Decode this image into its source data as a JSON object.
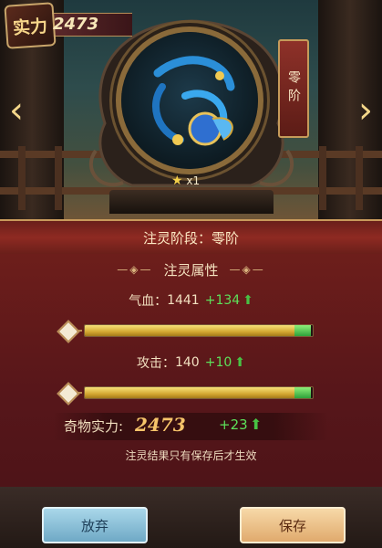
{
  "power": {
    "badge": "实力",
    "value": "2473"
  },
  "stage_tag": "零阶",
  "item": {
    "stars": "x1"
  },
  "stage_line": "注灵阶段：零阶",
  "section_title": "注灵属性",
  "section_deco_left": "—◈—",
  "section_deco_right": "—◈—",
  "attributes": [
    {
      "label": "气血：",
      "value": "1441",
      "increase": "+134",
      "bar_fill": 0.99
    },
    {
      "label": "攻击：",
      "value": "140",
      "increase": "+10",
      "bar_fill": 0.99
    }
  ],
  "total": {
    "label": "奇物实力:",
    "value": "2473",
    "increase": "+23"
  },
  "notice": "注灵结果只有保存后才生效",
  "buttons": {
    "discard": "放弃",
    "save": "保存"
  },
  "icons": {
    "arrow_left": "‹",
    "arrow_right": "›",
    "star": "★",
    "up_arrow": "⬆"
  }
}
